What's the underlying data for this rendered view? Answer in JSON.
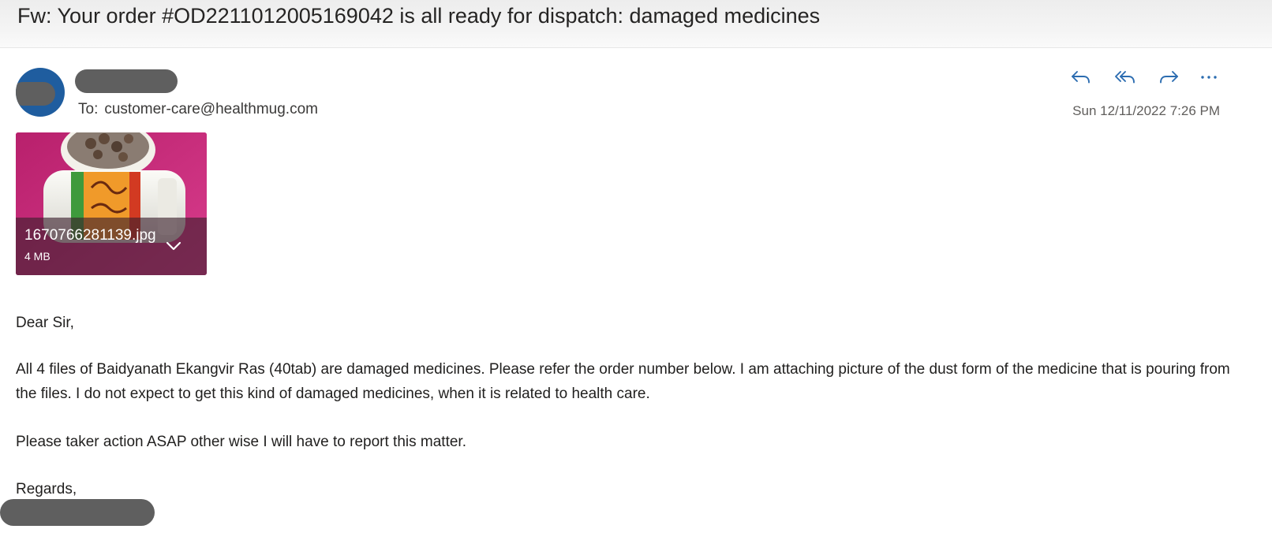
{
  "email": {
    "subject": "Fw: Your order #OD221101200516904​2 is all ready for dispatch: damaged medicines",
    "to_label": "To:",
    "to_address": "customer-care@healthmug.com",
    "date": "Sun 12/11/2022 7:26 PM",
    "actions": [
      {
        "name": "reply",
        "icon": "reply-icon"
      },
      {
        "name": "reply-all",
        "icon": "reply-all-icon"
      },
      {
        "name": "forward",
        "icon": "forward-icon"
      },
      {
        "name": "more",
        "icon": "more-icon"
      }
    ],
    "attachment": {
      "file_name": "1670766281139.jpg",
      "file_size": "4 MB",
      "chevron_icon": "chevron-down-icon"
    },
    "body": {
      "greeting": "Dear Sir,",
      "paragraph1": "All 4 files of Baidyanath Ekangvir Ras (40tab) are damaged medicines. Please refer the order number below. I am attaching picture of the dust form of the medicine that is pouring from the files. I do not expect to get this kind of damaged medicines, when it is related to health care.",
      "paragraph2": "Please taker action ASAP other wise I will have to report this matter.",
      "closing": "Regards,"
    }
  },
  "colors": {
    "accent": "#2b6cb0",
    "avatar": "#1f5d9f",
    "redaction": "#5f5f5f",
    "attachment_background": "#c8327c"
  }
}
